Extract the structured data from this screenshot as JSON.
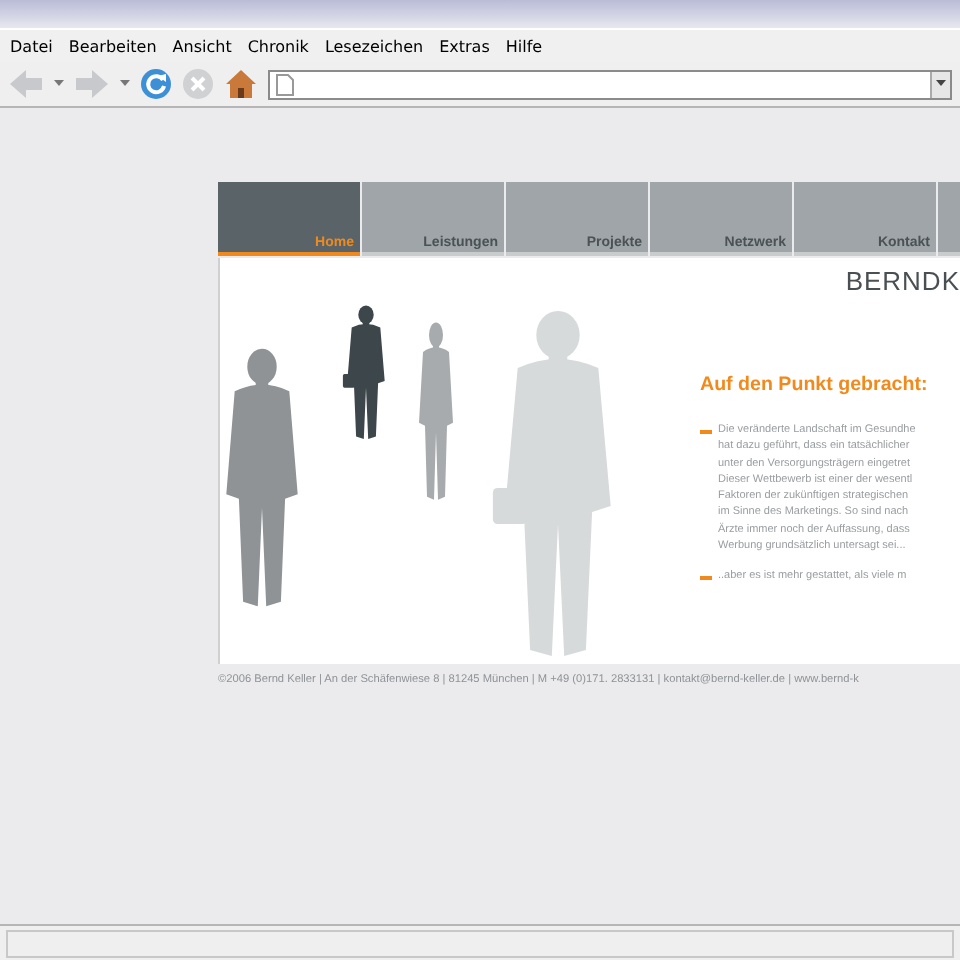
{
  "menu": [
    {
      "label": "Datei"
    },
    {
      "label": "Bearbeiten"
    },
    {
      "label": "Ansicht"
    },
    {
      "label": "Chronik"
    },
    {
      "label": "Lesezeichen"
    },
    {
      "label": "Extras"
    },
    {
      "label": "Hilfe"
    }
  ],
  "nav_tabs": [
    {
      "label": "Home",
      "selected": true
    },
    {
      "label": "Leistungen",
      "selected": false
    },
    {
      "label": "Projekte",
      "selected": false
    },
    {
      "label": "Netzwerk",
      "selected": false
    },
    {
      "label": "Kontakt",
      "selected": false
    }
  ],
  "logo": "BERNDK",
  "heading": "Auf den Punkt gebracht:",
  "paragraphs": [
    {
      "lines": [
        "Die veränderte Landschaft im Gesundhe",
        "hat dazu geführt, dass ein tatsächlicher",
        "unter den Versorgungsträgern eingetret",
        "Dieser Wettbewerb ist einer der wesentl",
        "Faktoren der zukünftigen strategischen",
        "im Sinne des Marketings. So sind nach",
        "Ärzte immer noch der Auffassung, dass",
        "Werbung grundsätzlich untersagt sei..."
      ]
    },
    {
      "lines": [
        "..aber es ist mehr gestattet, als viele m"
      ]
    }
  ],
  "footer": "©2006 Bernd Keller | An der Schäfenwiese 8 | 81245 München | M +49 (0)171. 2833131 | kontakt@bernd-keller.de | www.bernd-k"
}
